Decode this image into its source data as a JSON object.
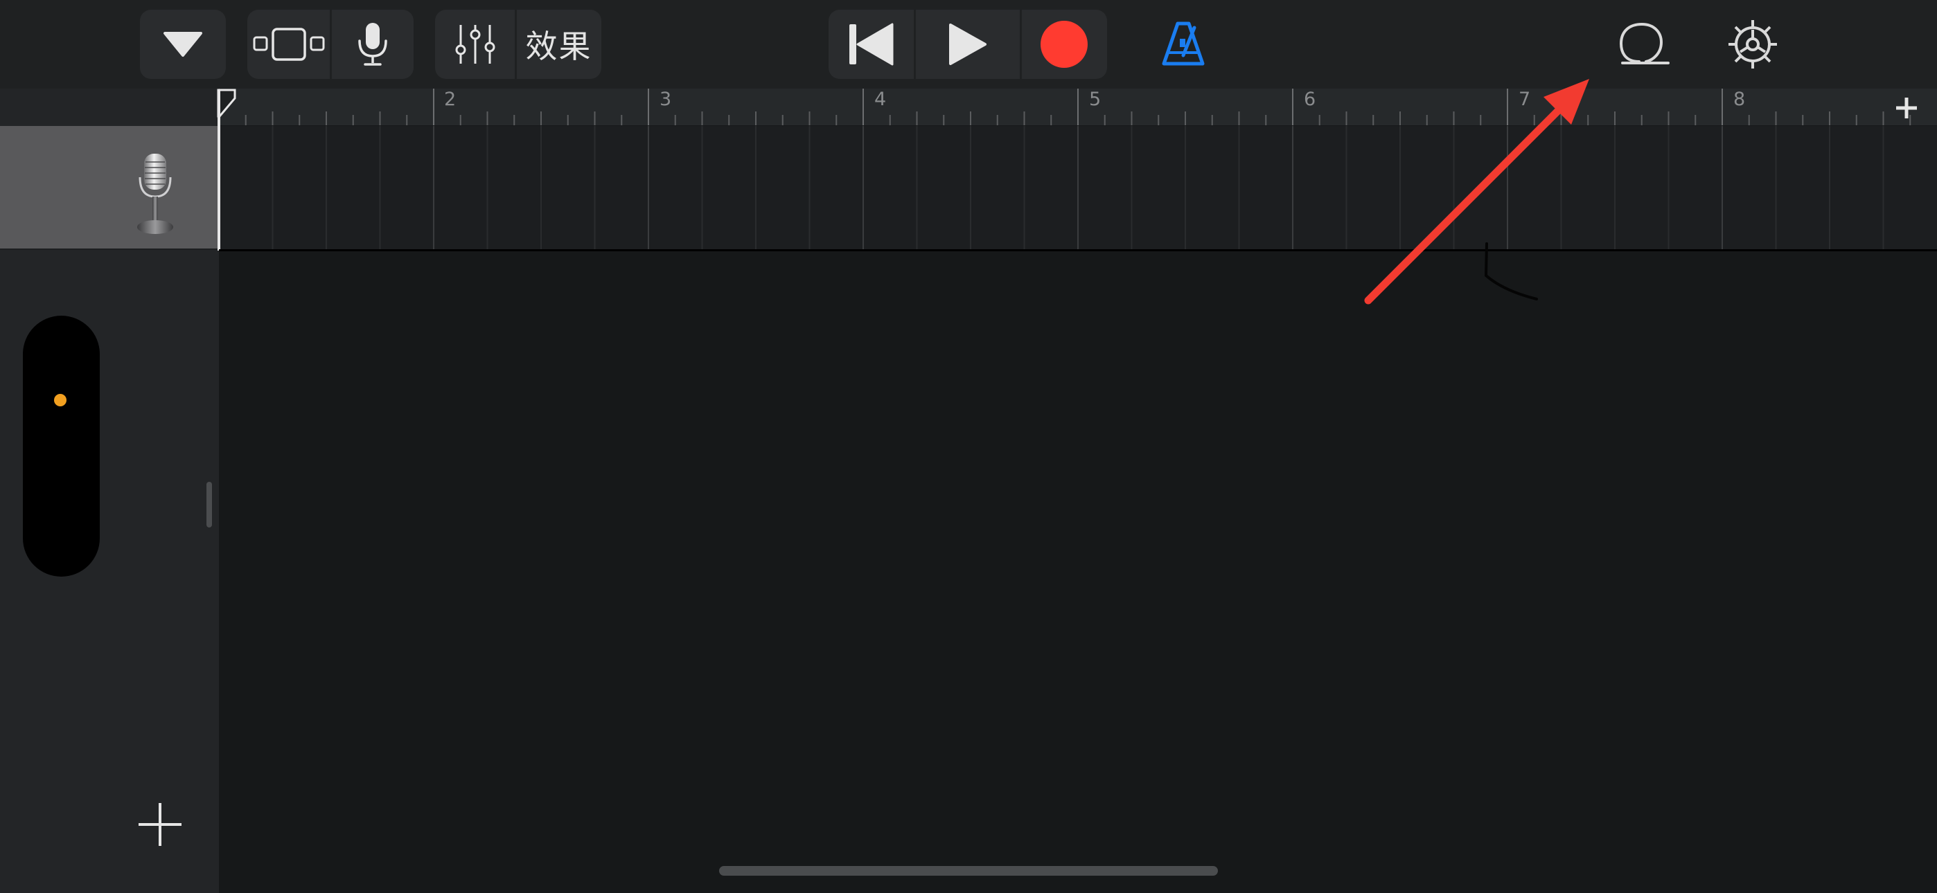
{
  "toolbar": {
    "effects_label": "效果",
    "record_color": "#ff3b30",
    "metronome_color": "#1a7df0",
    "accent_dot_color": "#f2a020"
  },
  "ruler": {
    "bars": [
      "2",
      "3",
      "4",
      "5",
      "6",
      "7",
      "8"
    ]
  },
  "track": {
    "instrument_icon": "microphone-icon"
  },
  "icons": {
    "dropdown": "triangle-down-icon",
    "tracks_view": "tracks-view-icon",
    "mic": "microphone-icon",
    "mixer": "mixer-sliders-icon",
    "rewind": "skip-back-icon",
    "play": "play-icon",
    "record": "record-icon",
    "metronome": "metronome-icon",
    "loop": "loop-browser-icon",
    "settings": "gear-icon",
    "add_section": "plus-icon",
    "add_track": "plus-icon"
  }
}
